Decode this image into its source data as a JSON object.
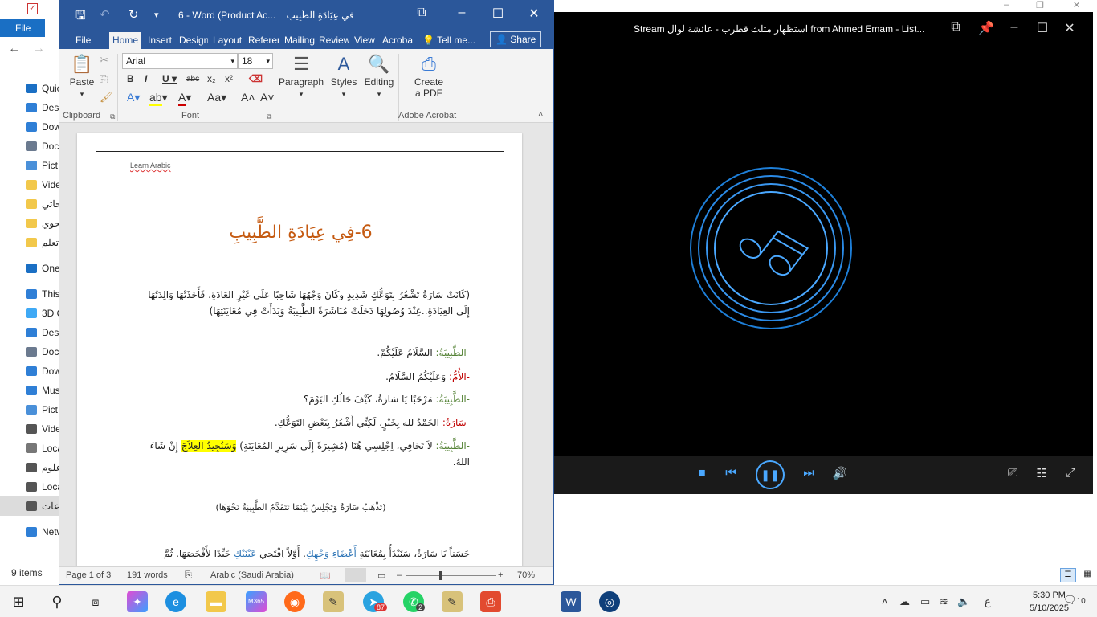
{
  "explorer": {
    "file_tab": "File",
    "nav_items": [
      {
        "label": "Quick",
        "icon": "star-icon",
        "color": "#1a6fc4"
      },
      {
        "label": "Desl",
        "icon": "desktop-icon",
        "color": "#2f7fd6"
      },
      {
        "label": "Dow",
        "icon": "download-icon",
        "color": "#2f7fd6"
      },
      {
        "label": "Doc",
        "icon": "document-icon",
        "color": "#6b7a8f"
      },
      {
        "label": "Pict",
        "icon": "pictures-icon",
        "color": "#4a90d9"
      },
      {
        "label": "Vide",
        "icon": "folder-icon",
        "color": "#f2c84b"
      },
      {
        "label": "حاتي",
        "icon": "folder-icon",
        "color": "#f2c84b"
      },
      {
        "label": "نحوي",
        "icon": "folder-icon",
        "color": "#f2c84b"
      },
      {
        "label": "تعلم",
        "icon": "folder-icon",
        "color": "#f2c84b"
      },
      {
        "label": "OneD",
        "icon": "onedrive-icon",
        "color": "#1a6fc4"
      },
      {
        "label": "This P",
        "icon": "computer-icon",
        "color": "#2f7fd6"
      },
      {
        "label": "3D O",
        "icon": "cube-icon",
        "color": "#3fa9f5"
      },
      {
        "label": "Desl",
        "icon": "desktop-icon",
        "color": "#2f7fd6"
      },
      {
        "label": "Doc",
        "icon": "document-icon",
        "color": "#6b7a8f"
      },
      {
        "label": "Dow",
        "icon": "download-icon",
        "color": "#2f7fd6"
      },
      {
        "label": "Mus",
        "icon": "music-icon",
        "color": "#2f7fd6"
      },
      {
        "label": "Pict",
        "icon": "pictures-icon",
        "color": "#4a90d9"
      },
      {
        "label": "Vide",
        "icon": "video-icon",
        "color": "#555555"
      },
      {
        "label": "Loca",
        "icon": "drive-icon",
        "color": "#777777"
      },
      {
        "label": "علوم",
        "icon": "drive-icon",
        "color": "#555555"
      },
      {
        "label": "Loca",
        "icon": "drive-icon",
        "color": "#555555"
      },
      {
        "label": "عات",
        "icon": "drive-icon",
        "color": "#555555"
      },
      {
        "label": "Netw",
        "icon": "network-icon",
        "color": "#2f7fd6"
      }
    ],
    "status": "9 items"
  },
  "word": {
    "window_title": "6 - Word (Product Ac...",
    "doc_name": "في عِيَادَةِ الطَّبِيبِ",
    "tabs": [
      "File",
      "Home",
      "Insert",
      "Design",
      "Layout",
      "References",
      "Mailings",
      "Review",
      "View",
      "Acrobat"
    ],
    "tell_me": "Tell me...",
    "share": "Share",
    "ribbon": {
      "paste": "Paste",
      "clipboard": "Clipboard",
      "font_name": "Arial",
      "font_size": "18",
      "font": "Font",
      "paragraph": "Paragraph",
      "styles": "Styles",
      "editing": "Editing",
      "create_pdf_1": "Create",
      "create_pdf_2": "a PDF",
      "adobe": "Adobe Acrobat"
    },
    "doc": {
      "header": "Learn Arabic",
      "title": "6-فِي عِيَادَةِ الطَّبِيبِ",
      "intro": "(كَانَتْ سَارَةُ تَشْعُرُ بِتَوَعُّكٍ شَدِيدٍ وكَانَ وَجْهُهَا شَاحِبًا عَلَى غَيْرِ العَادَةِ، فَأَخَذَتْهَا وَالِدَتُهَا إِلَى العِيَادَةِ..عِنْدَ وُصُولِهَا دَخَلَتْ مُبَاشَرَةً الطَّبِيبَةُ وَبَدَأَتْ فِي مُعَايَنَتِهَا)",
      "l1_speaker": "-الطَّبِيبَةُ:",
      "l1_text": " السَّلَامُ عَلَيْكُمْ.",
      "l2_speaker": "-الأُمُّ:",
      "l2_text": " وَعَلَيْكُمُ السَّلَامُ.",
      "l3_speaker": "-الطَّبِيبَةُ:",
      "l3_text": " مَرْحَبًا يَا سَارَةُ، كَيْفَ حَالُكِ اليَوْمَ؟",
      "l4_speaker": "-سَارَةُ:",
      "l4_text": " الحَمْدُ لله بِخَيْرٍ، لَكِنِّي أَشْعُرُ بِبَعْضِ التَوَعُّكِ.",
      "l5_speaker": "-الطَّبِيبَةُ:",
      "l5_text_a": " لاَ تَخَافِي، اِجْلِسِي هُنَا (مُشِيرَةً إِلَى سَرِيرِ المُعَايَنَةِ) ",
      "l5_highlight": "وَسَنُجِيدُ العِلاَجَ",
      "l5_text_b": " إِنْ شَاءَ اللهُ.",
      "stage": "(تَذْهَبُ سَارَةُ وَتَجْلِسُ بَيْنَمَا تَتَقَدَّمُ الطَّبِيبَةُ نَحْوَهَا)",
      "l6_a": "حَسَناً يَا سَارَةُ، سَنَبْدَأُ بِمُعَايَنَةِ ",
      "l6_blue": "أَعْضَاءِ وَجْهِكِ",
      "l6_b": ". أَوَّلاً اِفْتَحِي ",
      "l6_blue2": "عَيْنَيْكِ",
      "l6_c": " جَيِّدًا لأَفْحَصَهَا. ثُمَّ"
    },
    "status": {
      "page": "Page 1 of 3",
      "words": "191 words",
      "language": "Arabic (Saudi Arabia)",
      "zoom": "70%"
    }
  },
  "player": {
    "title": "Stream استظهار مثلث قطرب - عائشة لوال from Ahmed Emam - List...",
    "accent": "#4aa8ff"
  },
  "taskbar": {
    "telegram_badge": "87",
    "whatsapp_badge": "2",
    "m365_label": "M365",
    "lang": "ع",
    "time": "5:30 PM",
    "date": "5/10/2025",
    "notifications": "10"
  }
}
